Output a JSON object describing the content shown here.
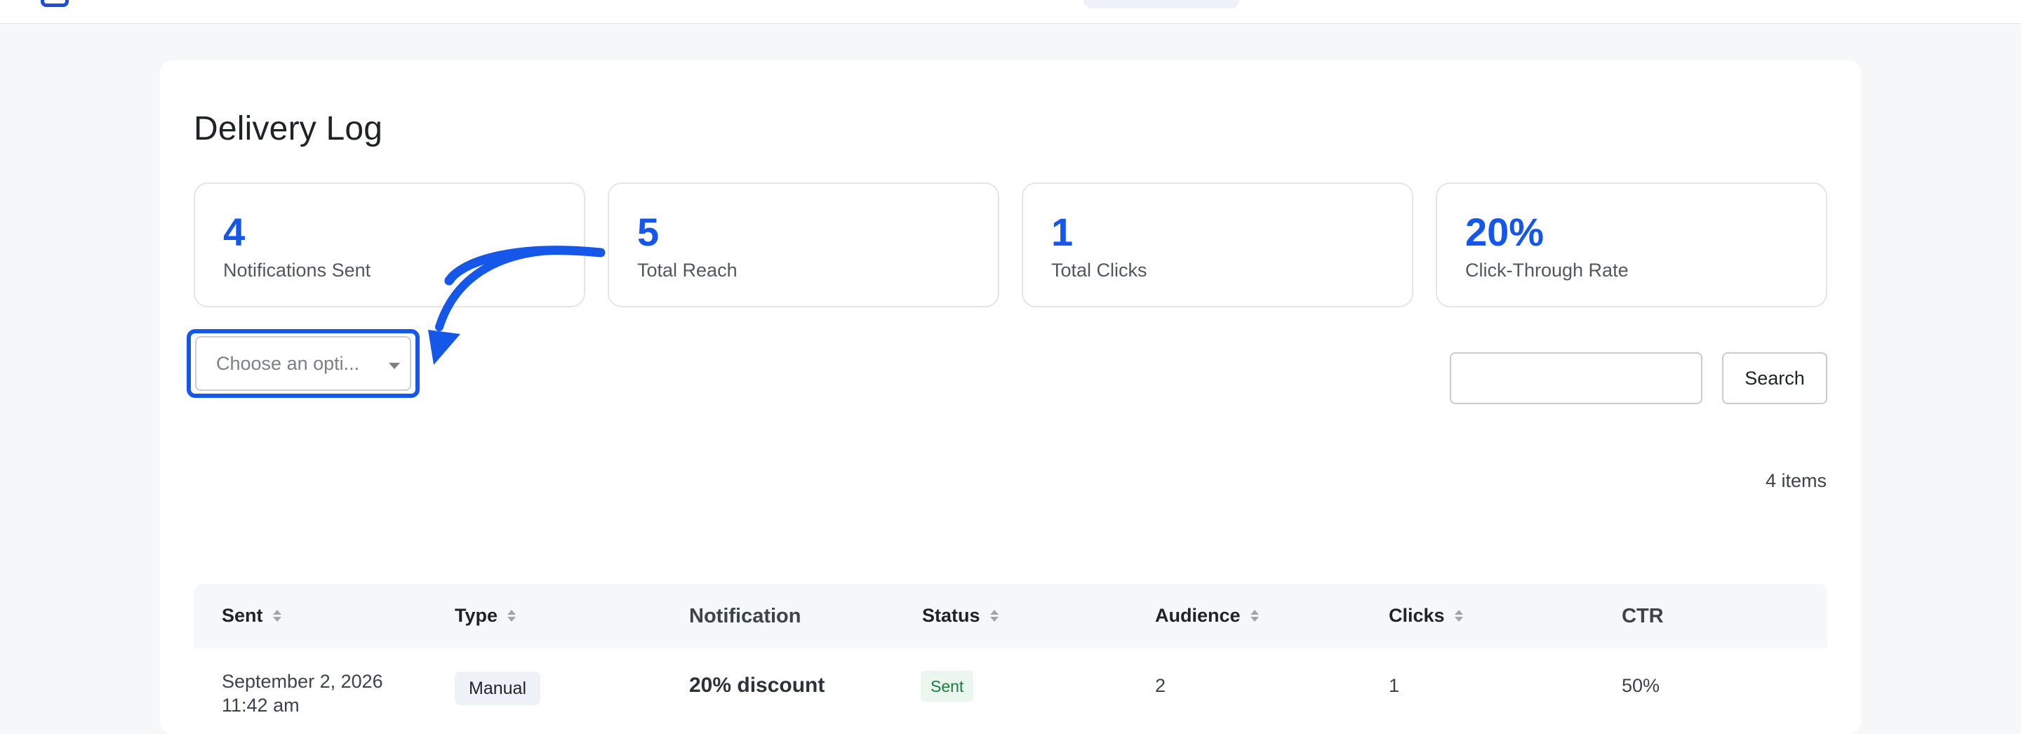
{
  "page": {
    "title": "Delivery Log"
  },
  "stats": [
    {
      "value": "4",
      "label": "Notifications Sent"
    },
    {
      "value": "5",
      "label": "Total Reach"
    },
    {
      "value": "1",
      "label": "Total Clicks"
    },
    {
      "value": "20%",
      "label": "Click-Through Rate"
    }
  ],
  "filter": {
    "placeholder": "Choose an opti..."
  },
  "search": {
    "value": "",
    "button_label": "Search"
  },
  "table": {
    "count_label": "4 items",
    "columns": [
      "Sent",
      "Type",
      "Notification",
      "Status",
      "Audience",
      "Clicks",
      "CTR"
    ],
    "rows": [
      {
        "sent_date": "September 2, 2026",
        "sent_time": "11:42 am",
        "type": "Manual",
        "notification": "20% discount",
        "status": "Sent",
        "audience": "2",
        "clicks": "1",
        "ctr": "50%"
      }
    ]
  },
  "colors": {
    "accent": "#1557e8",
    "status_sent": "#1b7d3a"
  },
  "icons": {
    "sort": "sort-arrows-icon",
    "dropdown": "chevron-down-icon",
    "annotation": "curved-arrow-icon"
  }
}
